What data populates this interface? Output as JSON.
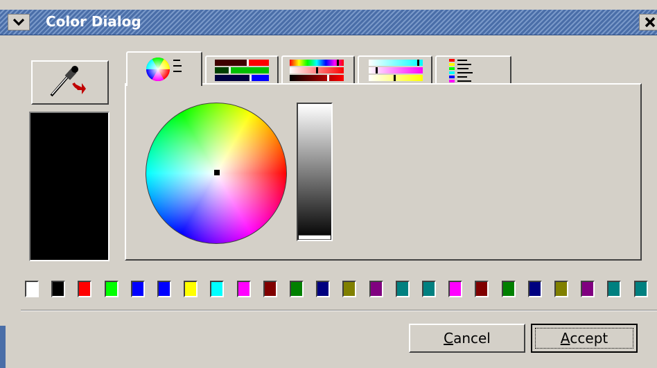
{
  "window": {
    "title": "Color Dialog",
    "menu_icon": "chevron-down-icon",
    "close_icon": "close-icon"
  },
  "picker": {
    "icon": "eyedropper-icon",
    "accent_color": "#c00000"
  },
  "current_color": "#000000",
  "tabs": [
    {
      "icon": "color-wheel-tab-icon",
      "active": true
    },
    {
      "icon": "rgb-sliders-tab-icon",
      "active": false
    },
    {
      "icon": "hsv-sliders-tab-icon",
      "active": false
    },
    {
      "icon": "cmy-sliders-tab-icon",
      "active": false
    },
    {
      "icon": "named-colors-tab-icon",
      "active": false
    }
  ],
  "wheel": {
    "selected_hue_saturation": "center",
    "value_level": 0.0
  },
  "palette": [
    "#ffffff",
    "#000000",
    "#ff0000",
    "#00ff00",
    "#0000ff",
    "#0000ff",
    "#ffff00",
    "#00ffff",
    "#ff00ff",
    "#800000",
    "#008000",
    "#000080",
    "#808000",
    "#800080",
    "#008080",
    "#008080",
    "#ff00ff",
    "#800000",
    "#008000",
    "#000080",
    "#808000",
    "#800080",
    "#008080",
    "#008080"
  ],
  "buttons": {
    "cancel_mnemonic": "C",
    "cancel_rest": "ancel",
    "accept_mnemonic": "A",
    "accept_rest": "ccept"
  }
}
